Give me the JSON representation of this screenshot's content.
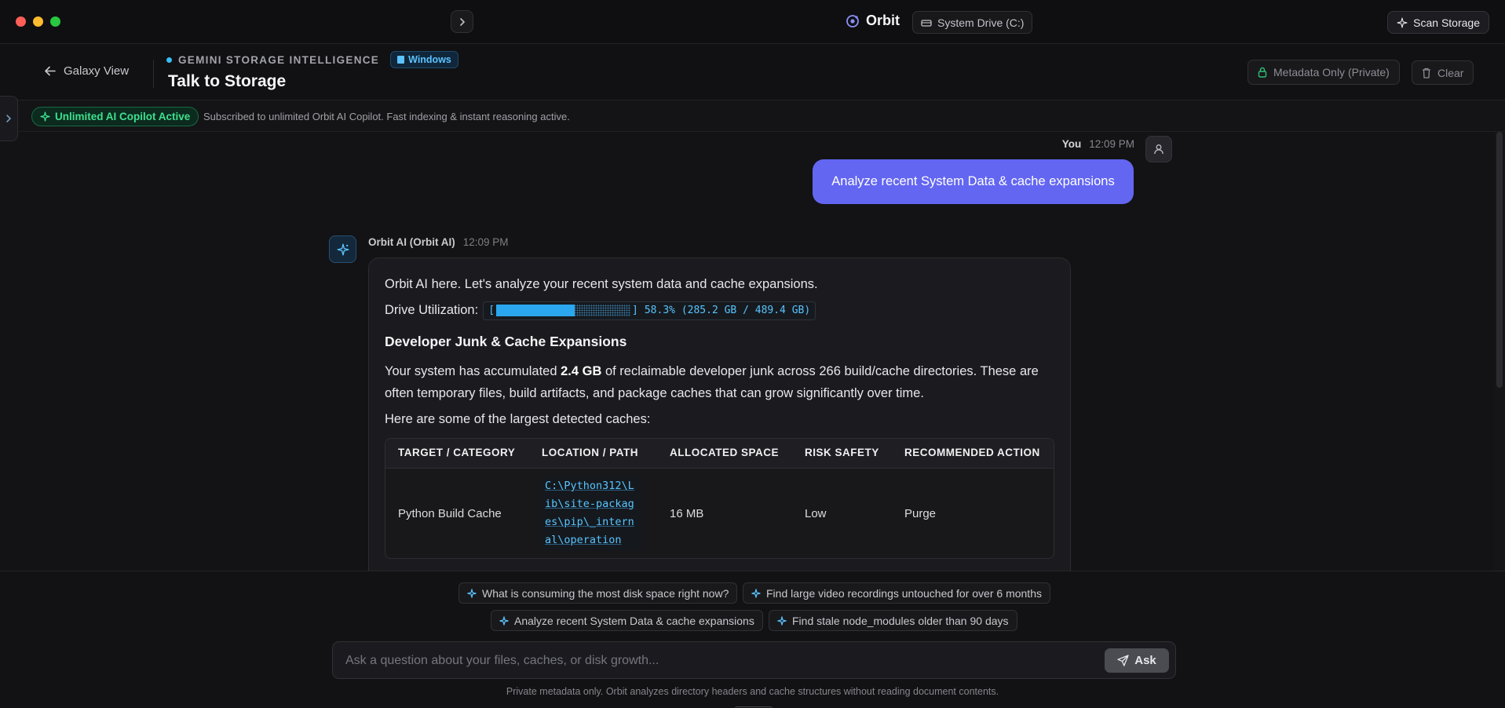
{
  "app": {
    "name": "Orbit",
    "drive": "System Drive (C:)",
    "scan_label": "Scan Storage"
  },
  "header": {
    "back_label": "Galaxy View",
    "eyebrow": "GEMINI STORAGE INTELLIGENCE",
    "os_badge": "Windows",
    "title": "Talk to Storage",
    "metadata_label": "Metadata Only (Private)",
    "clear_label": "Clear"
  },
  "subscription": {
    "pill": "Unlimited AI Copilot Active",
    "text": "Subscribed to unlimited Orbit AI Copilot. Fast indexing & instant reasoning active."
  },
  "user_message": {
    "sender": "You",
    "time": "12:09 PM",
    "text": "Analyze recent System Data & cache expansions"
  },
  "ai_message": {
    "sender": "Orbit AI (Orbit AI)",
    "time": "12:09 PM",
    "intro": "Orbit AI here. Let's analyze your recent system data and cache expansions.",
    "utilization_label": "Drive Utilization:",
    "utilization_open": "[",
    "utilization_close": "]",
    "utilization_fraction": 0.583,
    "utilization_text": "58.3% (285.2 GB / 489.4 GB)",
    "section_title": "Developer Junk & Cache Expansions",
    "para_before": "Your system has accumulated ",
    "para_bold": "2.4 GB",
    "para_after": " of reclaimable developer junk across 266 build/cache directories. These are often temporary files, build artifacts, and package caches that can grow significantly over time.",
    "list_intro": "Here are some of the largest detected caches:",
    "table": {
      "headers": [
        "TARGET / CATEGORY",
        "LOCATION / PATH",
        "ALLOCATED SPACE",
        "RISK SAFETY",
        "RECOMMENDED ACTION"
      ],
      "rows": [
        {
          "target": "Python Build Cache",
          "path": "C:\\Python312\\Lib\\site-packages\\pip\\_internal\\operation",
          "size": "16 MB",
          "risk": "Low",
          "action": "Purge"
        }
      ]
    }
  },
  "suggestions": [
    "What is consuming the most disk space right now?",
    "Find large video recordings untouched for over 6 months",
    "Analyze recent System Data & cache expansions",
    "Find stale node_modules older than 90 days"
  ],
  "composer": {
    "placeholder": "Ask a question about your files, caches, or disk growth...",
    "ask_label": "Ask",
    "privacy_note": "Private metadata only. Orbit analyzes directory headers and cache structures without reading document contents."
  }
}
